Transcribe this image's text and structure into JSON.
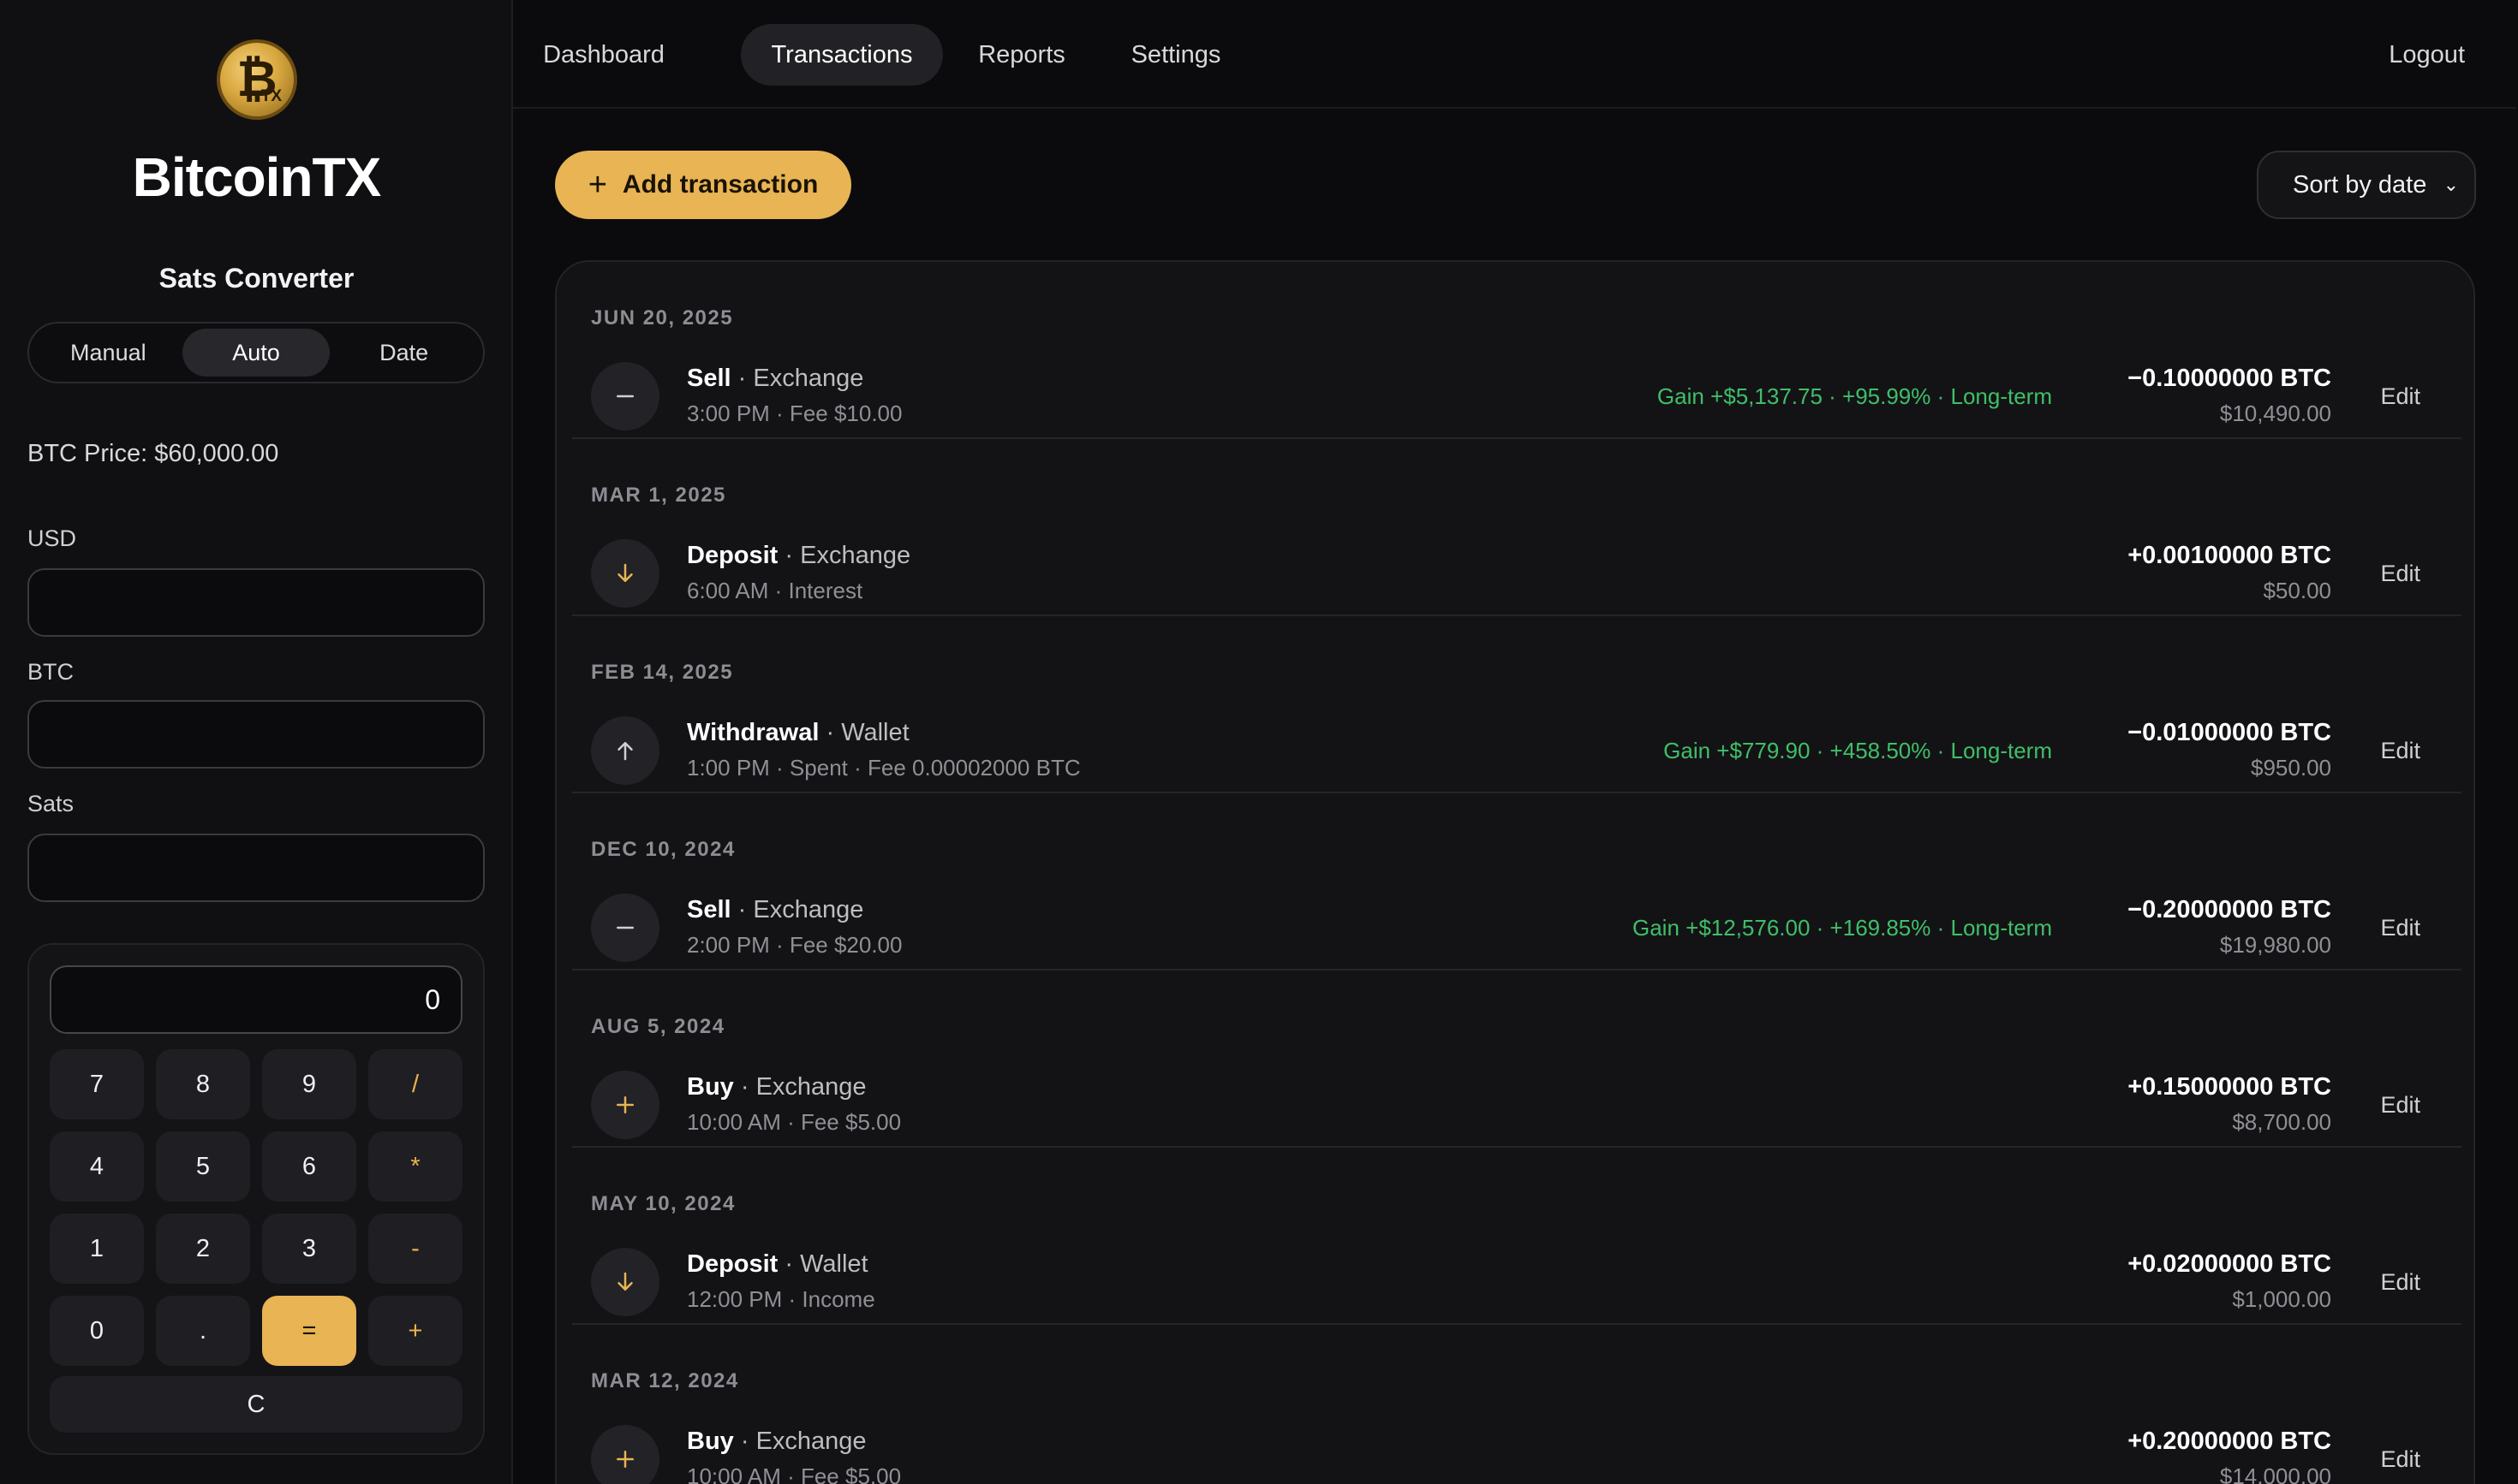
{
  "brand": {
    "name": "BitcoinTX",
    "logo_glyph": "₿",
    "logo_tag": "TX"
  },
  "converter": {
    "title": "Sats Converter",
    "modes": [
      "Manual",
      "Auto",
      "Date"
    ],
    "active_mode": "Auto",
    "btc_price": "BTC Price: $60,000.00",
    "usd_label": "USD",
    "btc_label": "BTC",
    "sats_label": "Sats",
    "usd_value": "",
    "btc_value": "",
    "sats_value": ""
  },
  "calculator": {
    "display": "0",
    "keys": [
      "7",
      "8",
      "9",
      "/",
      "4",
      "5",
      "6",
      "*",
      "1",
      "2",
      "3",
      "-",
      "0",
      ".",
      "=",
      "+"
    ],
    "clear": "C"
  },
  "nav": {
    "tabs": [
      "Dashboard",
      "Transactions",
      "Reports",
      "Settings"
    ],
    "active": "Transactions",
    "logout": "Logout"
  },
  "toolbar": {
    "add_label": "Add transaction",
    "sort_label": "Sort by date"
  },
  "transactions": [
    {
      "date": "JUN 20, 2025",
      "type": "Sell",
      "account": "Exchange",
      "sub": "3:00 PM · Fee $10.00",
      "gain": "Gain +$5,137.75 · +95.99% · Long-term",
      "btc": "−0.10000000 BTC",
      "usd": "$10,490.00",
      "icon": "minus-icon",
      "edit": "Edit"
    },
    {
      "date": "MAR 1, 2025",
      "type": "Deposit",
      "account": "Exchange",
      "sub": "6:00 AM · Interest",
      "gain": "",
      "btc": "+0.00100000 BTC",
      "usd": "$50.00",
      "icon": "arrow-down-icon",
      "edit": "Edit"
    },
    {
      "date": "FEB 14, 2025",
      "type": "Withdrawal",
      "account": "Wallet",
      "sub": "1:00 PM · Spent · Fee 0.00002000 BTC",
      "gain": "Gain +$779.90 · +458.50% · Long-term",
      "btc": "−0.01000000 BTC",
      "usd": "$950.00",
      "icon": "arrow-up-icon",
      "edit": "Edit"
    },
    {
      "date": "DEC 10, 2024",
      "type": "Sell",
      "account": "Exchange",
      "sub": "2:00 PM · Fee $20.00",
      "gain": "Gain +$12,576.00 · +169.85% · Long-term",
      "btc": "−0.20000000 BTC",
      "usd": "$19,980.00",
      "icon": "minus-icon",
      "edit": "Edit"
    },
    {
      "date": "AUG 5, 2024",
      "type": "Buy",
      "account": "Exchange",
      "sub": "10:00 AM · Fee $5.00",
      "gain": "",
      "btc": "+0.15000000 BTC",
      "usd": "$8,700.00",
      "icon": "plus-icon",
      "edit": "Edit"
    },
    {
      "date": "MAY 10, 2024",
      "type": "Deposit",
      "account": "Wallet",
      "sub": "12:00 PM · Income",
      "gain": "",
      "btc": "+0.02000000 BTC",
      "usd": "$1,000.00",
      "icon": "arrow-down-icon",
      "edit": "Edit"
    },
    {
      "date": "MAR 12, 2024",
      "type": "Buy",
      "account": "Exchange",
      "sub": "10:00 AM · Fee $5.00",
      "gain": "",
      "btc": "+0.20000000 BTC",
      "usd": "$14,000.00",
      "icon": "plus-icon",
      "edit": "Edit"
    }
  ],
  "colors": {
    "accent": "#e8b454",
    "gain": "#3fbf68",
    "icon_gold": "#e8b454",
    "icon_neutral": "#cfcfd4"
  }
}
